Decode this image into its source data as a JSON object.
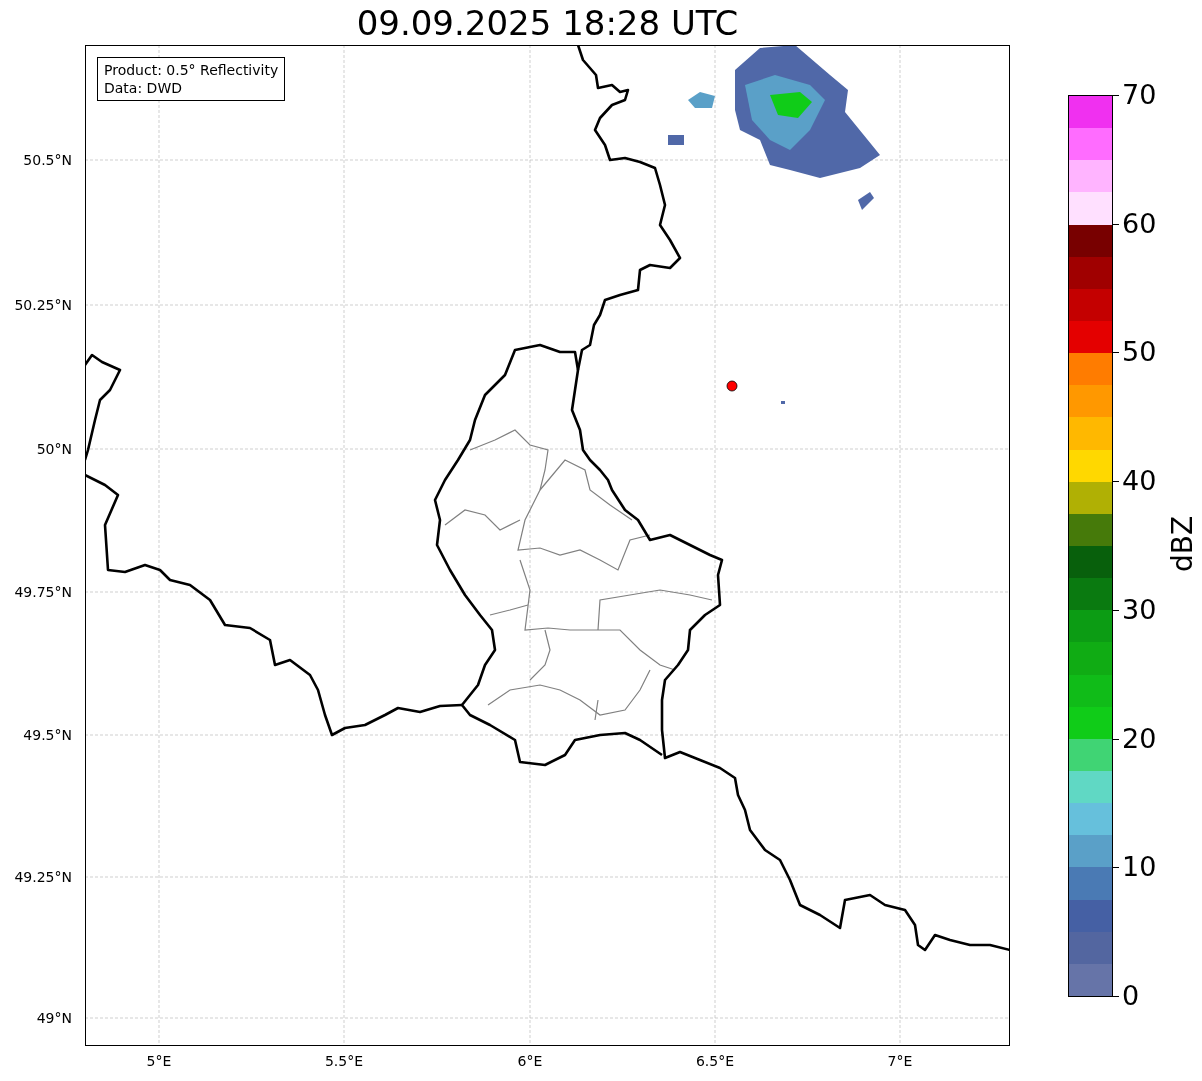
{
  "title": "09.09.2025 18:28 UTC",
  "info_box": {
    "lines": [
      "Product: 0.5° Reflectivity",
      "Data: DWD"
    ]
  },
  "map": {
    "lat_ticks": [
      "50.5°N",
      "50.25°N",
      "50°N",
      "49.75°N",
      "49.5°N",
      "49.25°N",
      "49°N"
    ],
    "lon_ticks": [
      "5°E",
      "5.5°E",
      "6°E",
      "6.5°E",
      "7°E"
    ]
  },
  "colorbar": {
    "label": "dBZ",
    "ticks": [
      "70",
      "60",
      "50",
      "40",
      "30",
      "20",
      "10",
      "0"
    ],
    "bands": [
      {
        "color": "#f030f0"
      },
      {
        "color": "#ff6cff"
      },
      {
        "color": "#ffb4ff"
      },
      {
        "color": "#ffe0ff"
      },
      {
        "color": "#780000"
      },
      {
        "color": "#a00000"
      },
      {
        "color": "#c40000"
      },
      {
        "color": "#e40000"
      },
      {
        "color": "#ff7c00"
      },
      {
        "color": "#ff9800"
      },
      {
        "color": "#ffb800"
      },
      {
        "color": "#ffd800"
      },
      {
        "color": "#b0b004"
      },
      {
        "color": "#467a0a"
      },
      {
        "color": "#08600c"
      },
      {
        "color": "#0a7a10"
      },
      {
        "color": "#0c9c14"
      },
      {
        "color": "#10ac14"
      },
      {
        "color": "#10bc18"
      },
      {
        "color": "#10cc18"
      },
      {
        "color": "#40d474"
      },
      {
        "color": "#60d8c4"
      },
      {
        "color": "#66c0dc"
      },
      {
        "color": "#5aa0c8"
      },
      {
        "color": "#4a7ab4"
      },
      {
        "color": "#4560a4"
      },
      {
        "color": "#5366a0"
      },
      {
        "color": "#6674a8"
      }
    ]
  }
}
